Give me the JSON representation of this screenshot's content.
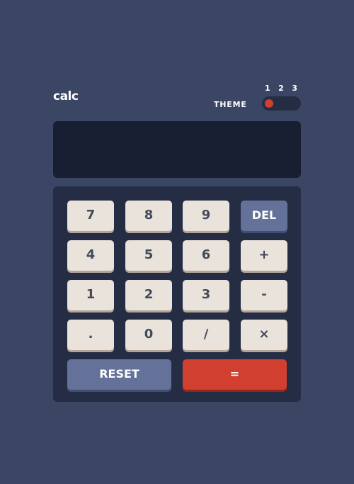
{
  "header": {
    "logo": "calc",
    "theme_label": "THEME",
    "theme_options": [
      "1",
      "2",
      "3"
    ],
    "active_theme": "1"
  },
  "display": {
    "value": ""
  },
  "keys": {
    "k7": "7",
    "k8": "8",
    "k9": "9",
    "del": "DEL",
    "k4": "4",
    "k5": "5",
    "k6": "6",
    "plus": "+",
    "k1": "1",
    "k2": "2",
    "k3": "3",
    "minus": "-",
    "dot": ".",
    "k0": "0",
    "divide": "/",
    "multiply": "×",
    "reset": "RESET",
    "equals": "="
  },
  "colors": {
    "background": "#3b4664",
    "keypad_background": "#252d44",
    "screen_background": "#181f33",
    "key": "#eae3dc",
    "key_text": "#434a59",
    "accent_key": "#647198",
    "equals_key": "#d03f2f",
    "toggle_knob": "#d03f2f"
  }
}
